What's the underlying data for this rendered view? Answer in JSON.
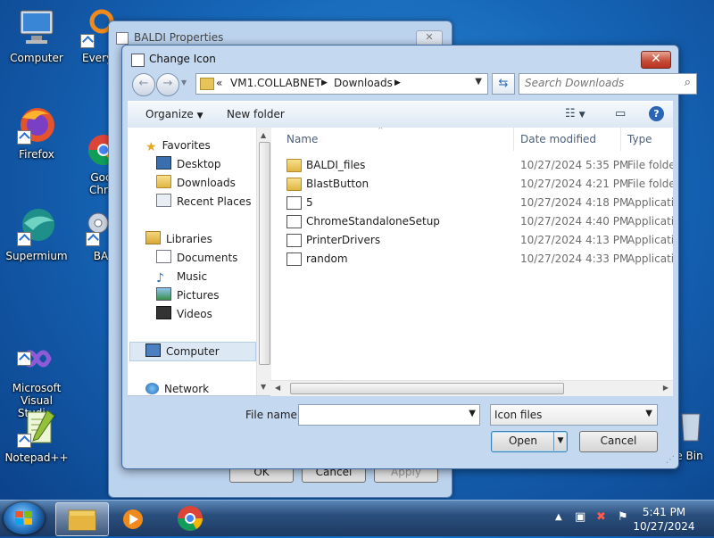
{
  "desktop": {
    "icons": [
      {
        "label": "Computer"
      },
      {
        "label": "Every"
      },
      {
        "label": "Firefox"
      },
      {
        "label": "Goc\nChro"
      },
      {
        "label": "Supermium"
      },
      {
        "label": "BA"
      },
      {
        "label": "Microsoft\nVisual Studi..."
      },
      {
        "label": "Notepad++"
      },
      {
        "label": "le Bin"
      }
    ]
  },
  "properties_window": {
    "title": "BALDI Properties",
    "ok_label": "OK",
    "cancel_label": "Cancel",
    "apply_label": "Apply"
  },
  "dialog": {
    "title": "Change Icon",
    "close_glyph": "✕",
    "address": {
      "prefix": "«",
      "crumbs": [
        "VM1.COLLABNET",
        "Downloads"
      ]
    },
    "search_placeholder": "Search Downloads",
    "toolbar": {
      "organize": "Organize",
      "new_folder": "New folder"
    },
    "nav": {
      "favorites": "Favorites",
      "desktop": "Desktop",
      "downloads": "Downloads",
      "recent": "Recent Places",
      "libraries": "Libraries",
      "documents": "Documents",
      "music": "Music",
      "pictures": "Pictures",
      "videos": "Videos",
      "computer": "Computer",
      "network": "Network"
    },
    "columns": {
      "name": "Name",
      "date": "Date modified",
      "type": "Type"
    },
    "files": [
      {
        "name": "BALDI_files",
        "date": "10/27/2024 5:35 PM",
        "type": "File folder",
        "icon": "folder"
      },
      {
        "name": "BlastButton",
        "date": "10/27/2024 4:21 PM",
        "type": "File folder",
        "icon": "folder"
      },
      {
        "name": "5",
        "date": "10/27/2024 4:18 PM",
        "type": "Application",
        "icon": "app"
      },
      {
        "name": "ChromeStandaloneSetup",
        "date": "10/27/2024 4:40 PM",
        "type": "Application",
        "icon": "app"
      },
      {
        "name": "PrinterDrivers",
        "date": "10/27/2024 4:13 PM",
        "type": "Application",
        "icon": "app"
      },
      {
        "name": "random",
        "date": "10/27/2024 4:33 PM",
        "type": "Application",
        "icon": "app"
      }
    ],
    "file_name_label": "File name:",
    "file_name_value": "",
    "filter_value": "Icon files",
    "open_label": "Open",
    "cancel_label": "Cancel"
  },
  "taskbar": {
    "time": "5:41 PM",
    "date": "10/27/2024"
  }
}
